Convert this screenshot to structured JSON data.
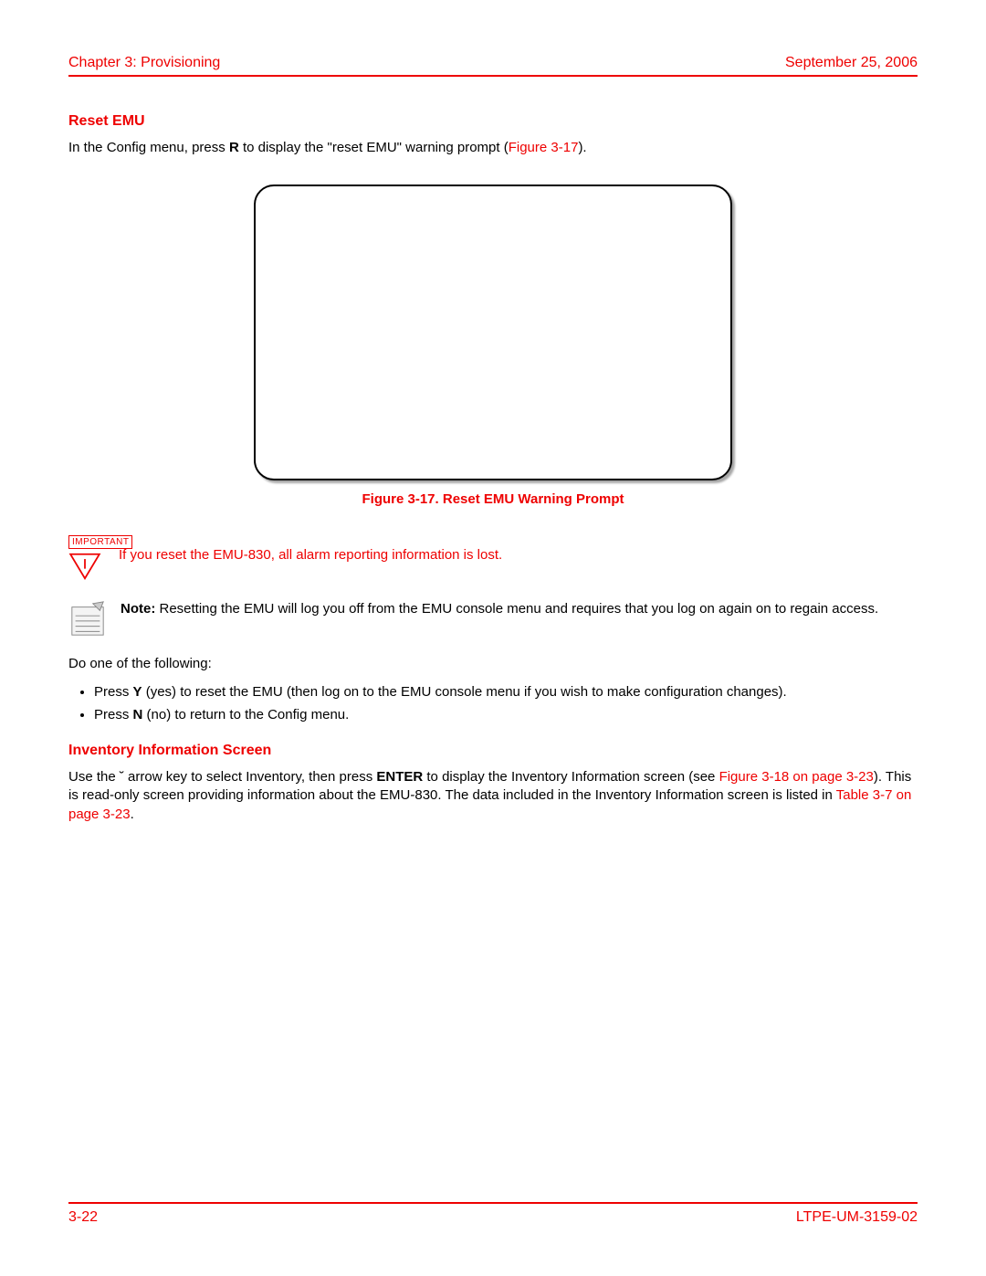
{
  "header": {
    "chapter": "Chapter 3: Provisioning",
    "date": "September 25, 2006"
  },
  "section1": {
    "heading": "Reset EMU",
    "intro_pre": "In the Config menu, press ",
    "intro_key": "R",
    "intro_post": " to display the \"reset EMU\" warning prompt (",
    "intro_linktext": "Figure 3-17",
    "intro_close": ")."
  },
  "figure": {
    "caption": "Figure 3-17. Reset EMU Warning Prompt"
  },
  "important": {
    "label": "IMPORTANT",
    "text": "If you reset the EMU-830, all alarm reporting information is lost."
  },
  "note": {
    "label": "Note:",
    "text": " Resetting the EMU will log you off from the EMU console menu and requires that you log on again on to regain access."
  },
  "instructions": {
    "lead": "Do one of the following:",
    "item1_pre": "Press ",
    "item1_key": "Y",
    "item1_post": " (yes) to reset the EMU (then log on to the EMU console menu if you wish to make configuration changes).",
    "item2_pre": "Press ",
    "item2_key": "N",
    "item2_post": " (no) to return to the Config menu."
  },
  "section2": {
    "heading": "Inventory Information Screen",
    "p1_pre": "Use the  ˘  arrow key to select Inventory, then press ",
    "p1_key": "ENTER",
    "p1_mid": " to display the Inventory Information screen (see ",
    "p1_link1": "Figure 3-18 on page 3-23",
    "p1_mid2": "). This is read-only screen providing information about the EMU-830. The data included in the Inventory Information screen is listed in ",
    "p1_link2": "Table 3-7 on page 3-23",
    "p1_end": "."
  },
  "footer": {
    "page": "3-22",
    "docid": "LTPE-UM-3159-02"
  }
}
